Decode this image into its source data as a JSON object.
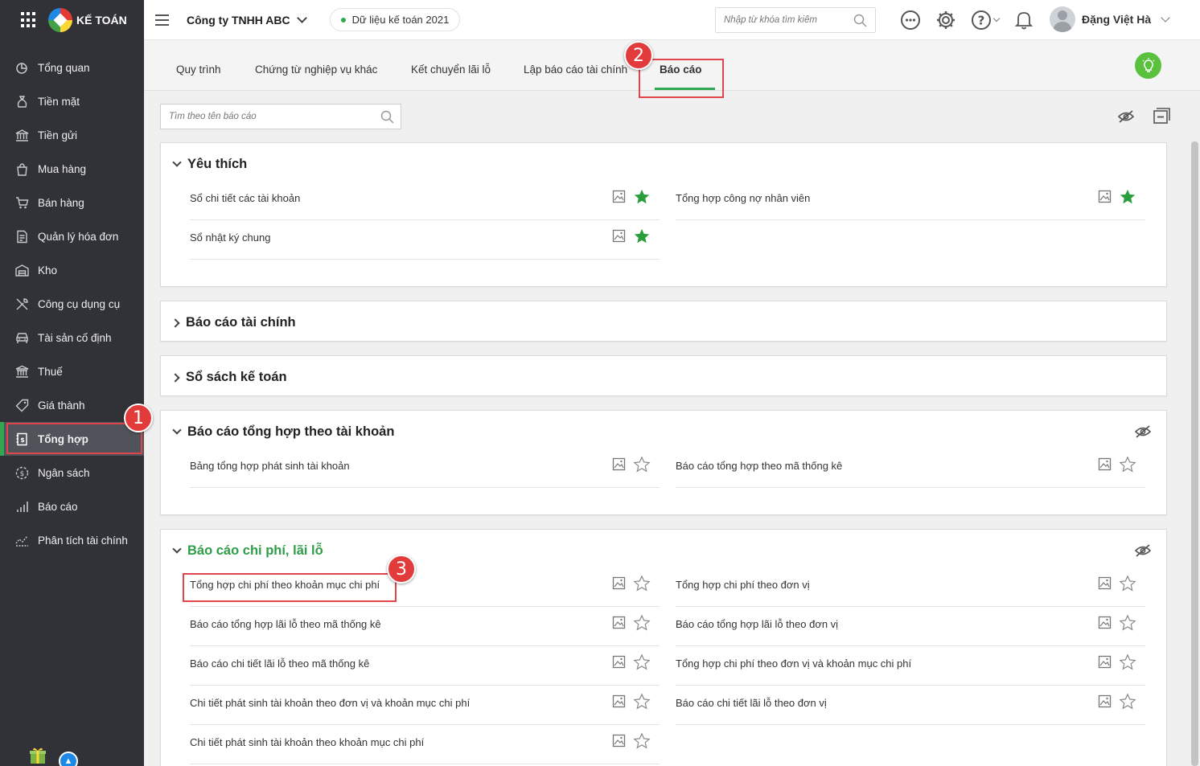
{
  "brand": {
    "name": "KẾ TOÁN"
  },
  "sidebar": {
    "items": [
      {
        "label": "Tổng quan",
        "icon": "dashboard-icon"
      },
      {
        "label": "Tiền mặt",
        "icon": "cash-bag-icon"
      },
      {
        "label": "Tiền gửi",
        "icon": "bank-icon"
      },
      {
        "label": "Mua hàng",
        "icon": "shopping-bag-icon"
      },
      {
        "label": "Bán hàng",
        "icon": "cart-icon"
      },
      {
        "label": "Quản lý hóa đơn",
        "icon": "invoice-icon"
      },
      {
        "label": "Kho",
        "icon": "warehouse-icon"
      },
      {
        "label": "Công cụ dụng cụ",
        "icon": "tools-icon"
      },
      {
        "label": "Tài sản cố định",
        "icon": "car-icon"
      },
      {
        "label": "Thuế",
        "icon": "government-icon"
      },
      {
        "label": "Giá thành",
        "icon": "price-tag-icon"
      },
      {
        "label": "Tổng hợp",
        "icon": "ledger-icon",
        "active": true
      },
      {
        "label": "Ngân sách",
        "icon": "budget-icon"
      },
      {
        "label": "Báo cáo",
        "icon": "bar-chart-icon"
      },
      {
        "label": "Phân tích tài chính",
        "icon": "analysis-icon"
      }
    ]
  },
  "header": {
    "company": "Công ty TNHH ABC",
    "data_year": "Dữ liệu kế toán 2021",
    "search_placeholder": "Nhập từ khóa tìm kiếm",
    "user_name": "Đặng Việt Hà"
  },
  "tabs": [
    {
      "label": "Quy trình"
    },
    {
      "label": "Chứng từ nghiệp vụ khác"
    },
    {
      "label": "Kết chuyển lãi lỗ"
    },
    {
      "label": "Lập báo cáo tài chính"
    },
    {
      "label": "Báo cáo",
      "active": true
    }
  ],
  "report_search": {
    "placeholder": "Tìm theo tên báo cáo"
  },
  "annotations": {
    "step1": "1",
    "step2": "2",
    "step3": "3"
  },
  "sections": [
    {
      "title": "Yêu thích",
      "expanded": true,
      "left": [
        {
          "label": "Sổ chi tiết các tài khoản",
          "starred": true
        },
        {
          "label": "Sổ nhật ký chung",
          "starred": true
        }
      ],
      "right": [
        {
          "label": "Tổng hợp công nợ nhân viên",
          "starred": true
        }
      ]
    },
    {
      "title": "Báo cáo tài chính",
      "expanded": false
    },
    {
      "title": "Sổ sách kế toán",
      "expanded": false
    },
    {
      "title": "Báo cáo tổng hợp theo tài khoản",
      "expanded": true,
      "left": [
        {
          "label": "Bảng tổng hợp phát sinh tài khoản",
          "starred": false
        }
      ],
      "right": [
        {
          "label": "Báo cáo tổng hợp theo mã thống kê",
          "starred": false
        }
      ]
    },
    {
      "title": "Báo cáo chi phí, lãi lỗ",
      "expanded": true,
      "highlight": true,
      "left": [
        {
          "label": "Tổng hợp chi phí theo khoản mục chi phí",
          "starred": false
        },
        {
          "label": "Báo cáo tổng hợp lãi lỗ theo mã thống kê",
          "starred": false
        },
        {
          "label": "Báo cáo chi tiết lãi lỗ theo mã thống kê",
          "starred": false
        },
        {
          "label": "Chi tiết phát sinh tài khoản theo đơn vị và khoản mục chi phí",
          "starred": false
        },
        {
          "label": "Chi tiết phát sinh tài khoản theo khoản mục chi phí",
          "starred": false
        }
      ],
      "right": [
        {
          "label": "Tổng hợp chi phí theo đơn vị",
          "starred": false
        },
        {
          "label": "Báo cáo tổng hợp lãi lỗ theo đơn vị",
          "starred": false
        },
        {
          "label": "Tổng hợp chi phí theo đơn vị và khoản mục chi phí",
          "starred": false
        },
        {
          "label": "Báo cáo chi tiết lãi lỗ theo đơn vị",
          "starred": false
        }
      ]
    }
  ],
  "colors": {
    "sidebar_bg": "#303237",
    "accent_green": "#2fa84f",
    "highlight_red": "#e0454b",
    "star_green": "#2a9d3c"
  }
}
